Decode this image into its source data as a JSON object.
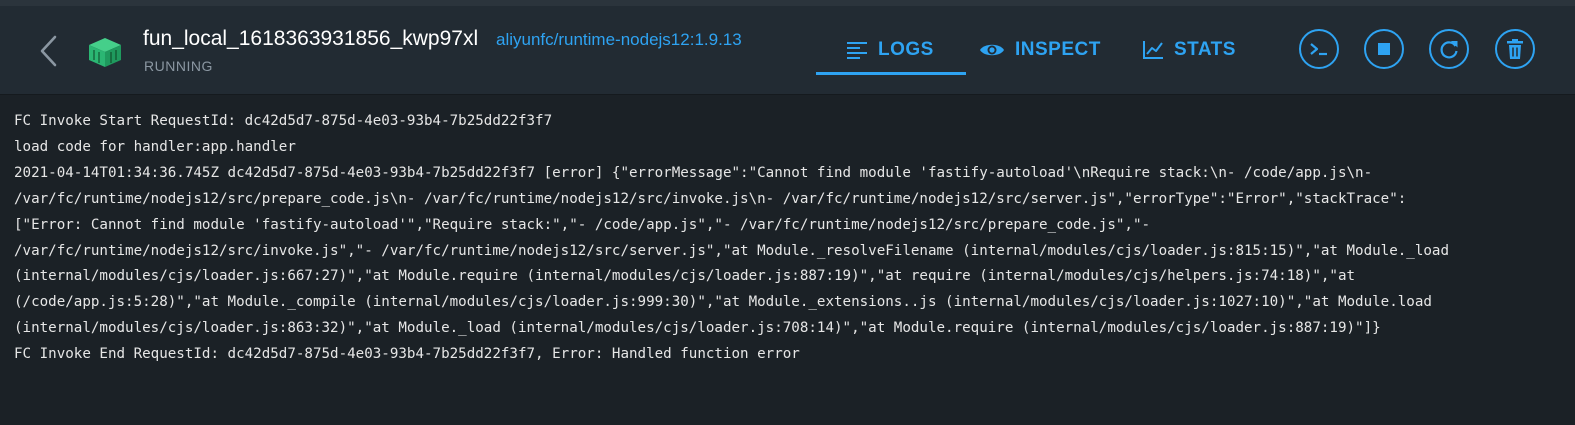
{
  "header": {
    "container_name": "fun_local_1618363931856_kwp97xl",
    "image": "aliyunfc/runtime-nodejs12:1.9.13",
    "status": "RUNNING"
  },
  "tabs": [
    {
      "label": "LOGS",
      "icon": "lines-icon",
      "active": true
    },
    {
      "label": "INSPECT",
      "icon": "eye-icon",
      "active": false
    },
    {
      "label": "STATS",
      "icon": "chart-icon",
      "active": false
    }
  ],
  "actions": [
    {
      "name": "cli",
      "icon": "terminal-icon"
    },
    {
      "name": "stop",
      "icon": "stop-icon"
    },
    {
      "name": "restart",
      "icon": "restart-icon"
    },
    {
      "name": "delete",
      "icon": "trash-icon"
    }
  ],
  "colors": {
    "accent": "#2ea3f2",
    "container_icon": "#2bb673",
    "background": "#1b2126",
    "header_background": "#222b33"
  },
  "logs": [
    "FC Invoke Start RequestId: dc42d5d7-875d-4e03-93b4-7b25dd22f3f7",
    "load code for handler:app.handler",
    "2021-04-14T01:34:36.745Z dc42d5d7-875d-4e03-93b4-7b25dd22f3f7 [error] {\"errorMessage\":\"Cannot find module 'fastify-autoload'\\nRequire stack:\\n- /code/app.js\\n-",
    "/var/fc/runtime/nodejs12/src/prepare_code.js\\n- /var/fc/runtime/nodejs12/src/invoke.js\\n- /var/fc/runtime/nodejs12/src/server.js\",\"errorType\":\"Error\",\"stackTrace\":",
    "[\"Error: Cannot find module 'fastify-autoload'\",\"Require stack:\",\"- /code/app.js\",\"- /var/fc/runtime/nodejs12/src/prepare_code.js\",\"-",
    "/var/fc/runtime/nodejs12/src/invoke.js\",\"- /var/fc/runtime/nodejs12/src/server.js\",\"at Module._resolveFilename (internal/modules/cjs/loader.js:815:15)\",\"at Module._load",
    "(internal/modules/cjs/loader.js:667:27)\",\"at Module.require (internal/modules/cjs/loader.js:887:19)\",\"at require (internal/modules/cjs/helpers.js:74:18)\",\"at",
    "(/code/app.js:5:28)\",\"at Module._compile (internal/modules/cjs/loader.js:999:30)\",\"at Module._extensions..js (internal/modules/cjs/loader.js:1027:10)\",\"at Module.load",
    "(internal/modules/cjs/loader.js:863:32)\",\"at Module._load (internal/modules/cjs/loader.js:708:14)\",\"at Module.require (internal/modules/cjs/loader.js:887:19)\"]}",
    "FC Invoke End RequestId: dc42d5d7-875d-4e03-93b4-7b25dd22f3f7, Error: Handled function error"
  ]
}
